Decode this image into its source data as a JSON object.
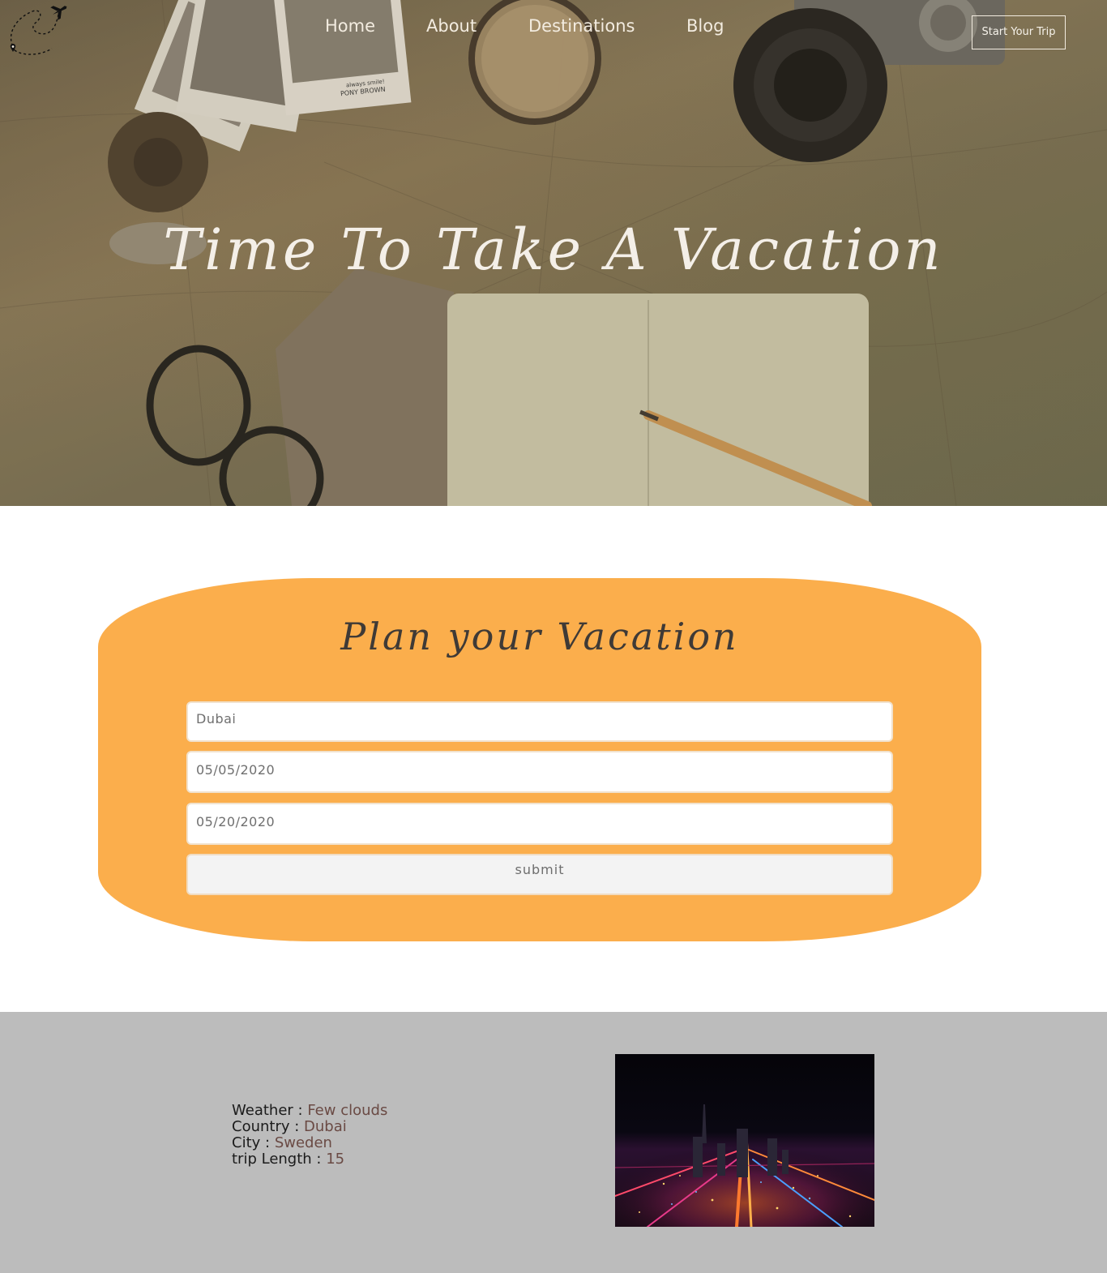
{
  "nav": {
    "links": [
      "Home",
      "About",
      "Destinations",
      "Blog"
    ],
    "cta_label": "Start Your Trip"
  },
  "hero": {
    "title": "Time To Take A Vacation",
    "postcard_caption_1": "always smile!",
    "postcard_caption_2": "PONY BROWN"
  },
  "plan": {
    "title": "Plan your Vacation",
    "destination_value": "Dubai",
    "start_date_value": "05/05/2020",
    "end_date_value": "05/20/2020",
    "submit_label": "submit"
  },
  "results": {
    "weather_label": "Weather :",
    "weather_value": "Few clouds",
    "country_label": "Country :",
    "country_value": "Dubai",
    "city_label": "City :",
    "city_value": "Sweden",
    "length_label": "trip Length :",
    "length_value": "15"
  },
  "colors": {
    "card": "#fbae4c",
    "results_bg": "#bcbcbc",
    "value_text": "#6a4a44"
  },
  "icons": {
    "logo": "airplane-dotted-route-icon",
    "pin": "location-pin-icon"
  }
}
